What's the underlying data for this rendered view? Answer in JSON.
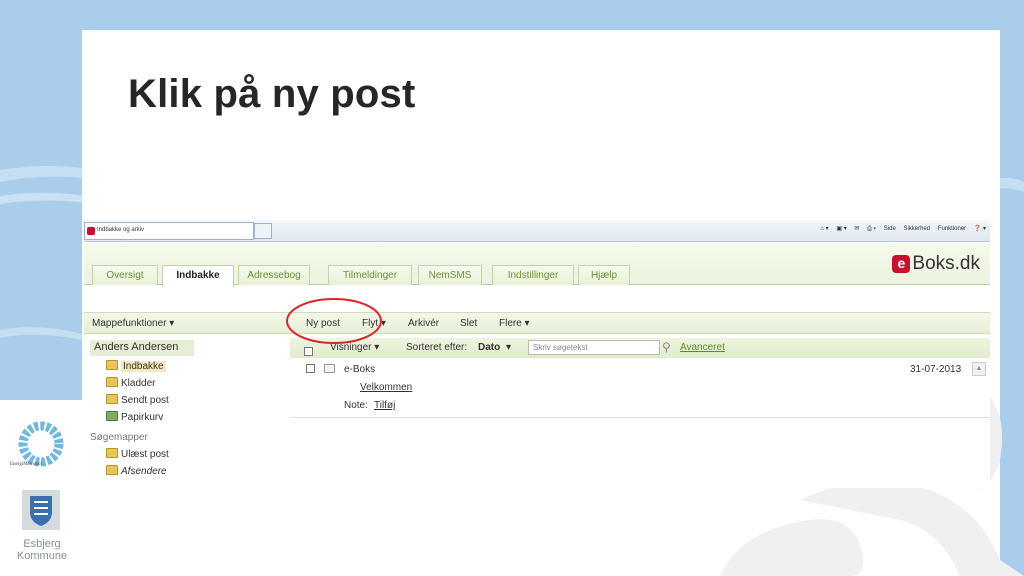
{
  "slide": {
    "title": "Klik på ny post"
  },
  "browser": {
    "tab_title": "Indbakke og arkiv",
    "tools": [
      "Side",
      "Sikkerhed",
      "Funktioner"
    ]
  },
  "eboks": {
    "tabs": [
      "Oversigt",
      "Indbakke",
      "Adressebog",
      "Tilmeldinger",
      "NemSMS",
      "Indstillinger",
      "Hjælp"
    ],
    "active_tab": "Indbakke",
    "logo_mark": "e",
    "logo_text": "Boks.dk",
    "folder_functions": "Mappefunktioner ▾",
    "actions": {
      "new_post": "Ny post",
      "move": "Flyt ▾",
      "archive": "Arkivér",
      "delete": "Slet",
      "more": "Flere ▾"
    },
    "user_name": "Anders Andersen",
    "folders": [
      "Indbakke",
      "Kladder",
      "Sendt post",
      "Papirkurv"
    ],
    "search_folders_header": "Søgemapper",
    "search_folders": [
      "Ulæst post",
      "Afsendere"
    ],
    "list_header": {
      "views": "Visninger ▾",
      "sort_label": "Sorteret efter:",
      "sort_value": "Dato",
      "sort_arrow": "▾",
      "search_placeholder": "Skriv søgetekst",
      "advanced": "Avanceret"
    },
    "message": {
      "sender": "e-Boks",
      "date": "31-07-2013",
      "subject": "Velkommen",
      "note_label": "Note:",
      "note_action": "Tilføj"
    }
  },
  "branding": {
    "energi_logo_text": "EnergiMetropol",
    "esbjerg_line1": "Esbjerg",
    "esbjerg_line2": "Kommune"
  },
  "colors": {
    "highlight": "#d9262c",
    "eboks_red": "#c8102e",
    "link_green": "#5a8a2a",
    "slide_background": "#a9cdea"
  }
}
